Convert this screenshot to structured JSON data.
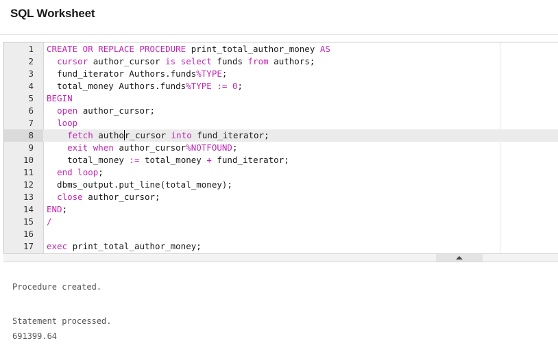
{
  "header": {
    "title": "SQL Worksheet"
  },
  "editor": {
    "active_line": 8,
    "lines": [
      {
        "num": "1",
        "tokens": [
          {
            "t": "CREATE OR REPLACE PROCEDURE",
            "k": true
          },
          {
            "t": " print_total_author_money "
          },
          {
            "t": "AS",
            "k": true
          }
        ]
      },
      {
        "num": "2",
        "tokens": [
          {
            "t": "  "
          },
          {
            "t": "cursor",
            "k": true
          },
          {
            "t": " author_cursor "
          },
          {
            "t": "is select",
            "k": true
          },
          {
            "t": " funds "
          },
          {
            "t": "from",
            "k": true
          },
          {
            "t": " authors;"
          }
        ]
      },
      {
        "num": "3",
        "tokens": [
          {
            "t": "  fund_iterator Authors.funds"
          },
          {
            "t": "%TYPE",
            "k": true
          },
          {
            "t": ";"
          }
        ]
      },
      {
        "num": "4",
        "tokens": [
          {
            "t": "  total_money Authors.funds"
          },
          {
            "t": "%TYPE",
            "k": true
          },
          {
            "t": " "
          },
          {
            "t": ":=",
            "k": true
          },
          {
            "t": " "
          },
          {
            "t": "0",
            "k": true
          },
          {
            "t": ";"
          }
        ]
      },
      {
        "num": "5",
        "tokens": [
          {
            "t": "BEGIN",
            "k": true
          }
        ]
      },
      {
        "num": "6",
        "tokens": [
          {
            "t": "  "
          },
          {
            "t": "open",
            "k": true
          },
          {
            "t": " author_cursor;"
          }
        ]
      },
      {
        "num": "7",
        "tokens": [
          {
            "t": "  "
          },
          {
            "t": "loop",
            "k": true
          }
        ]
      },
      {
        "num": "8",
        "tokens": [
          {
            "t": "    "
          },
          {
            "t": "fetch",
            "k": true
          },
          {
            "t": " autho"
          },
          {
            "caret": true
          },
          {
            "t": "r_cursor "
          },
          {
            "t": "into",
            "k": true
          },
          {
            "t": " fund_iterator;"
          }
        ]
      },
      {
        "num": "9",
        "tokens": [
          {
            "t": "    "
          },
          {
            "t": "exit when",
            "k": true
          },
          {
            "t": " author_cursor"
          },
          {
            "t": "%NOTFOUND",
            "k": true
          },
          {
            "t": ";"
          }
        ]
      },
      {
        "num": "10",
        "tokens": [
          {
            "t": "    total_money "
          },
          {
            "t": ":=",
            "k": true
          },
          {
            "t": " total_money "
          },
          {
            "t": "+",
            "k": true
          },
          {
            "t": " fund_iterator;"
          }
        ]
      },
      {
        "num": "11",
        "tokens": [
          {
            "t": "  "
          },
          {
            "t": "end loop",
            "k": true
          },
          {
            "t": ";"
          }
        ]
      },
      {
        "num": "12",
        "tokens": [
          {
            "t": "  dbms_output.put_line(total_money);"
          }
        ]
      },
      {
        "num": "13",
        "tokens": [
          {
            "t": "  "
          },
          {
            "t": "close",
            "k": true
          },
          {
            "t": " author_cursor;"
          }
        ]
      },
      {
        "num": "14",
        "tokens": [
          {
            "t": "END",
            "k": true
          },
          {
            "t": ";"
          }
        ]
      },
      {
        "num": "15",
        "tokens": [
          {
            "t": "/",
            "k": true
          }
        ]
      },
      {
        "num": "16",
        "tokens": []
      },
      {
        "num": "17",
        "tokens": [
          {
            "t": "exec",
            "k": true
          },
          {
            "t": " print_total_author_money;"
          }
        ]
      }
    ]
  },
  "results": {
    "lines": [
      "Procedure created.",
      "Statement processed.",
      "691399.64"
    ]
  },
  "colors": {
    "keyword": "#c026b3",
    "text": "#1a1a1a",
    "gutter": "#ededed",
    "active_line": "#ebebeb"
  },
  "icons": {
    "splitter_toggle": "caret-up-icon"
  }
}
